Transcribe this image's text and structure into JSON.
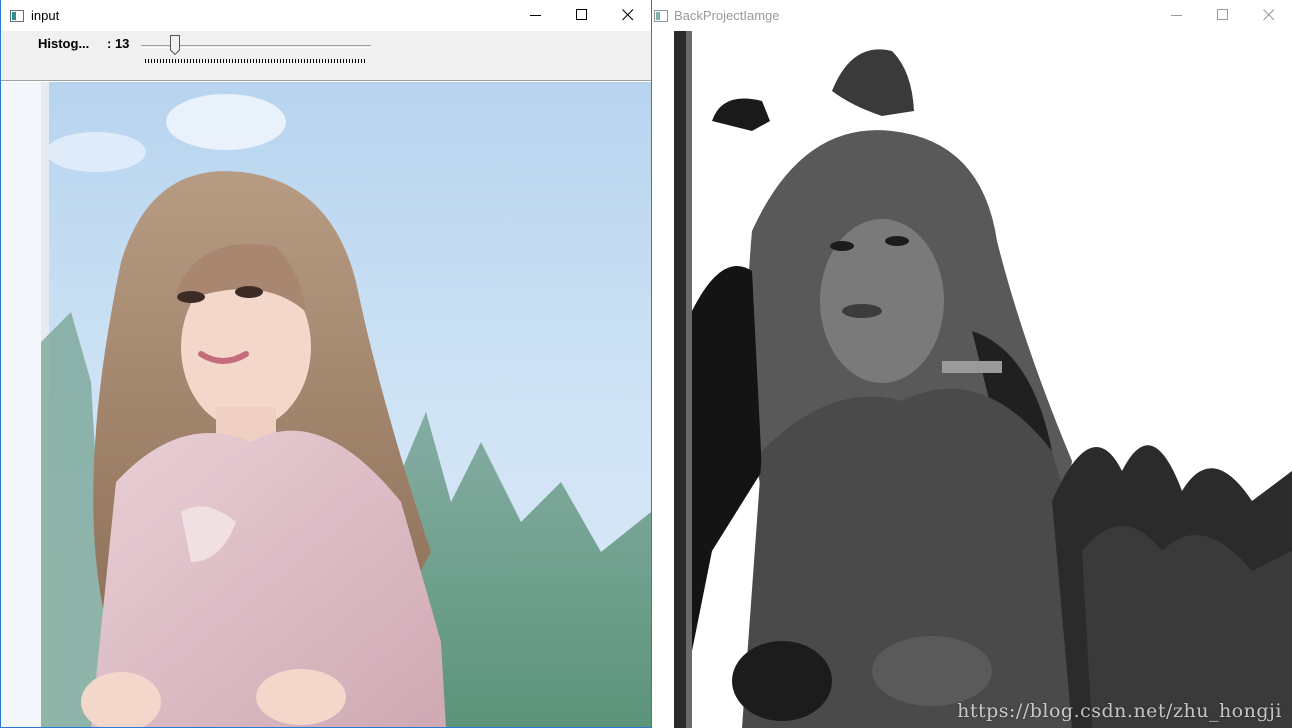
{
  "windows": {
    "input": {
      "title": "input",
      "icon": "opencv-window-icon",
      "controls": {
        "minimize": "minimize-icon",
        "maximize": "maximize-icon",
        "close": "close-icon"
      },
      "trackbar": {
        "label": "Histog...",
        "value_text": ": 13",
        "value": 13,
        "fraction": 0.13
      },
      "image": "photo-woman-pink-shirt-sky-background"
    },
    "backproject": {
      "title": "BackProjectIamge",
      "icon": "opencv-window-icon",
      "controls": {
        "minimize": "minimize-icon",
        "maximize": "maximize-icon",
        "close": "close-icon"
      },
      "image": "grayscale-backprojection-result"
    }
  },
  "watermark": "https://blog.csdn.net/zhu_hongji",
  "colors": {
    "active_border": "#2b79d0",
    "inactive_title": "#9a9a9a",
    "panel_bg": "#f0f0f0"
  }
}
